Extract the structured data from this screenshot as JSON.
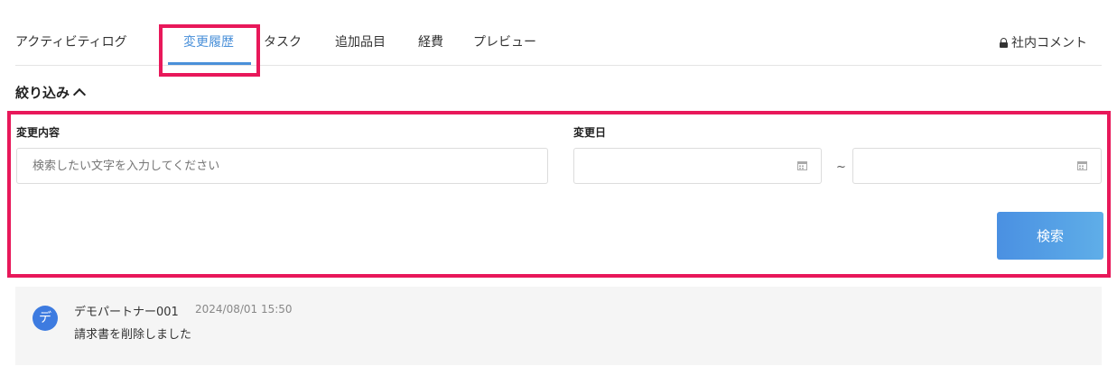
{
  "tabs": {
    "items": [
      {
        "label": "アクティビティログ",
        "active": false
      },
      {
        "label": "変更履歴",
        "active": true
      },
      {
        "label": "タスク",
        "active": false
      },
      {
        "label": "追加品目",
        "active": false
      },
      {
        "label": "経費",
        "active": false
      },
      {
        "label": "プレビュー",
        "active": false
      }
    ],
    "internal_comment": "社内コメント",
    "internal_comment_icon": "lock-icon"
  },
  "filter": {
    "toggle_label": "絞り込み",
    "toggle_icon": "chevron-up-icon",
    "change_content_label": "変更内容",
    "change_content_placeholder": "検索したい文字を入力してください",
    "change_date_label": "変更日",
    "date_from_value": "",
    "date_to_value": "",
    "date_icon": "calendar-icon",
    "range_separator": "~",
    "search_button": "検索"
  },
  "history": [
    {
      "avatar_char": "デ",
      "author": "デモパートナー001",
      "timestamp": "2024/08/01 15:50",
      "message": "請求書を削除しました"
    }
  ],
  "colors": {
    "accent": "#4a90d9",
    "highlight": "#e8185a",
    "avatar": "#3d7be0"
  }
}
